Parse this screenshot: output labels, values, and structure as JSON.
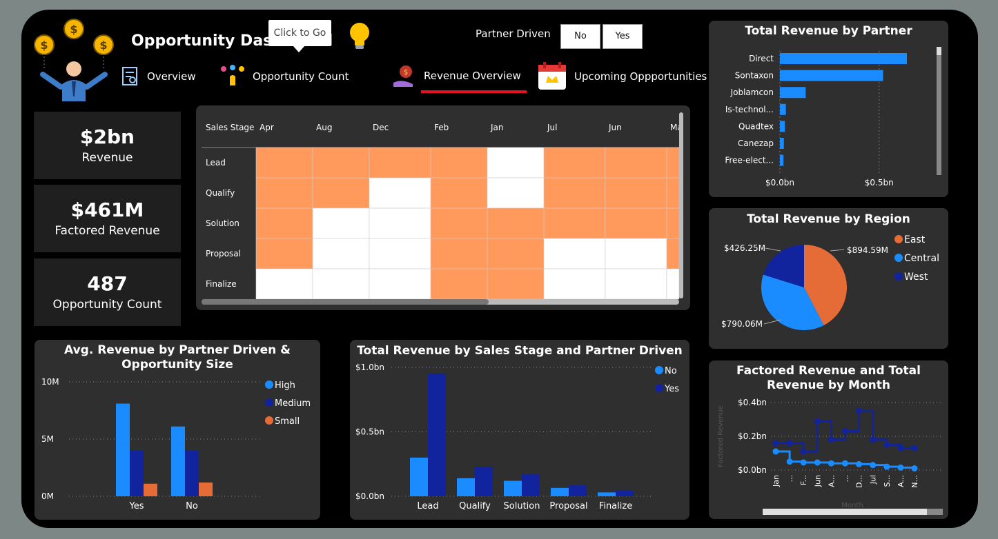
{
  "header": {
    "title": "Opportunity Dashboard",
    "tooltip": "Click to Go",
    "filter_label": "Partner Driven",
    "filter_options": [
      "No",
      "Yes"
    ]
  },
  "nav": [
    {
      "label": "Overview",
      "icon": "report-icon"
    },
    {
      "label": "Opportunity Count",
      "icon": "keys-icon"
    },
    {
      "label": "Revenue Overview",
      "icon": "money-hand-icon",
      "active": true
    },
    {
      "label": "Upcoming Oppportunities",
      "icon": "calendar-icon"
    }
  ],
  "kpis": [
    {
      "value": "$2bn",
      "label": "Revenue"
    },
    {
      "value": "$461M",
      "label": "Factored Revenue"
    },
    {
      "value": "487",
      "label": "Opportunity Count"
    }
  ],
  "matrix": {
    "corner": "Sales Stage",
    "columns": [
      "Apr",
      "Aug",
      "Dec",
      "Feb",
      "Jan",
      "Jul",
      "Jun",
      "Ma"
    ],
    "rows": [
      "Lead",
      "Qualify",
      "Solution",
      "Proposal",
      "Finalize"
    ],
    "cells": [
      [
        1,
        1,
        1,
        1,
        0,
        1,
        1,
        1
      ],
      [
        1,
        1,
        0,
        1,
        0,
        1,
        1,
        1
      ],
      [
        1,
        0,
        0,
        1,
        1,
        1,
        1,
        1
      ],
      [
        1,
        0,
        0,
        1,
        1,
        0,
        0,
        1
      ],
      [
        0,
        0,
        0,
        1,
        1,
        0,
        0,
        0
      ]
    ],
    "colors": {
      "filled": "#ff9a5c",
      "empty": "#ffffff"
    }
  },
  "colors": {
    "accent_blue": "#1a8cff",
    "dark_blue": "#12239e",
    "orange": "#e66c37",
    "active_underline": "#e81123"
  },
  "chart_data": [
    {
      "id": "partner",
      "type": "bar",
      "orientation": "horizontal",
      "title": "Total Revenue by Partner",
      "categories": [
        "Direct",
        "Sontaxon",
        "Joblamcon",
        "Is-technol...",
        "Quadtex",
        "Canezap",
        "Free-elect..."
      ],
      "values": [
        0.64,
        0.52,
        0.13,
        0.03,
        0.025,
        0.02,
        0.018
      ],
      "xlim": [
        0,
        0.8
      ],
      "xticks": [
        "$0.0bn",
        "$0.5bn"
      ],
      "color": "#1a8cff"
    },
    {
      "id": "region",
      "type": "pie",
      "title": "Total Revenue by Region",
      "labels": [
        "East",
        "Central",
        "West"
      ],
      "values": [
        894.59,
        790.06,
        426.25
      ],
      "value_labels": [
        "$894.59M",
        "$790.06M",
        "$426.25M"
      ],
      "colors": [
        "#e66c37",
        "#1a8cff",
        "#12239e"
      ]
    },
    {
      "id": "avg",
      "type": "bar",
      "title": "Avg. Revenue by Partner Driven & Opportunity Size",
      "categories": [
        "Yes",
        "No"
      ],
      "series": [
        {
          "name": "High",
          "values": [
            8.1,
            6.1
          ],
          "color": "#1a8cff"
        },
        {
          "name": "Medium",
          "values": [
            4.0,
            4.0
          ],
          "color": "#12239e"
        },
        {
          "name": "Small",
          "values": [
            1.1,
            1.2
          ],
          "color": "#e66c37"
        }
      ],
      "ylim": [
        0,
        10
      ],
      "yticks": [
        "0M",
        "5M",
        "10M"
      ]
    },
    {
      "id": "stage",
      "type": "bar",
      "title": "Total Revenue by Sales Stage and Partner Driven",
      "categories": [
        "Lead",
        "Qualify",
        "Solution",
        "Proposal",
        "Finalize"
      ],
      "series": [
        {
          "name": "No",
          "values": [
            0.3,
            0.14,
            0.12,
            0.065,
            0.03
          ],
          "color": "#1a8cff"
        },
        {
          "name": "Yes",
          "values": [
            0.95,
            0.23,
            0.17,
            0.085,
            0.045
          ],
          "color": "#12239e"
        }
      ],
      "ylim": [
        0,
        1.0
      ],
      "yticks": [
        "$0.0bn",
        "$0.5bn",
        "$1.0bn"
      ]
    },
    {
      "id": "month",
      "type": "line",
      "title": "Factored Revenue and Total Revenue by Month",
      "xlabel": "Month",
      "ylabel": "Factored Revenue",
      "x": [
        "Jan",
        "...",
        "F...",
        "Jun",
        "A...",
        "...",
        "D...",
        "Jul",
        "S...",
        "A...",
        "N..."
      ],
      "series": [
        {
          "name": "Total Revenue",
          "values": [
            0.16,
            0.16,
            0.11,
            0.29,
            0.18,
            0.23,
            0.35,
            0.18,
            0.15,
            0.13,
            0.13
          ],
          "color": "#12239e"
        },
        {
          "name": "Factored Revenue",
          "values": [
            0.11,
            0.05,
            0.045,
            0.045,
            0.04,
            0.04,
            0.035,
            0.03,
            0.02,
            0.015,
            0.01
          ],
          "color": "#1a8cff"
        }
      ],
      "ylim": [
        0,
        0.4
      ],
      "yticks": [
        "$0.0bn",
        "$0.2bn",
        "$0.4bn"
      ]
    }
  ]
}
